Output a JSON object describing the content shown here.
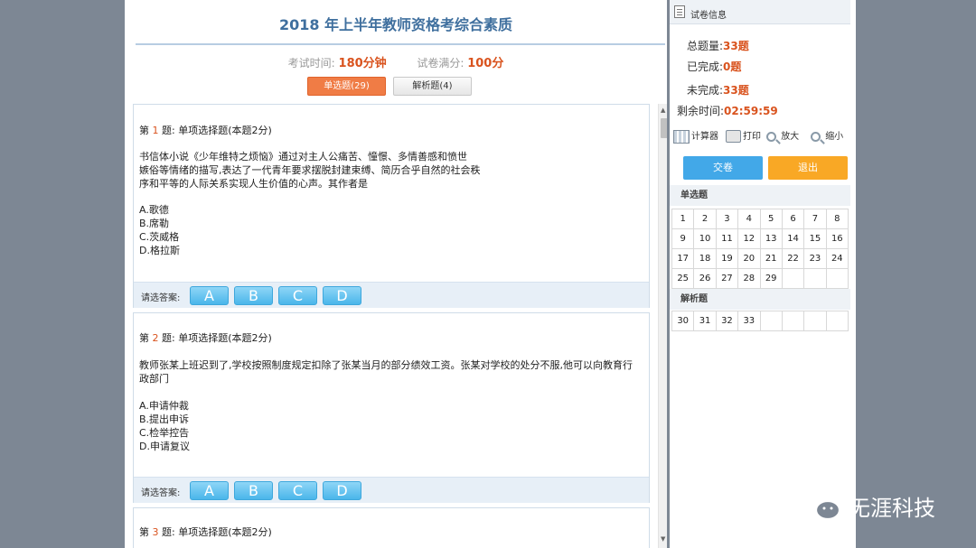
{
  "exam": {
    "title": "2018 年上半年教师资格考综合素质",
    "time_label": "考试时间:",
    "time_value": "180分钟",
    "score_label": "试卷满分:",
    "score_value": "100分"
  },
  "tabs": [
    {
      "label": "单选题(29)",
      "active": true
    },
    {
      "label": "解析题(4)",
      "active": false
    }
  ],
  "questions": [
    {
      "prefix": "第",
      "number": "1",
      "suffix": "题:  单项选择题(本题2分)",
      "text": "书信体小说《少年维特之烦恼》通过对主人公痛苦、憧憬、多情善感和愤世\n嫉俗等情绪的描写,表达了一代青年要求摆脱封建束缚、简历合乎自然的社会秩\n序和平等的人际关系实现人生价值的心声。其作者是",
      "options": [
        "A.歌德",
        "B.席勒",
        "C.茨威格",
        "D.格拉斯"
      ]
    },
    {
      "prefix": "第",
      "number": "2",
      "suffix": "题:  单项选择题(本题2分)",
      "text": "教师张某上班迟到了,学校按照制度规定扣除了张某当月的部分绩效工资。张某对学校的处分不服,他可以向教育行\n政部门",
      "options": [
        "A.申请仲裁",
        "B.提出申诉",
        "C.检举控告",
        "D.申请复议"
      ]
    },
    {
      "prefix": "第",
      "number": "3",
      "suffix": "题:  单项选择题(本题2分)"
    }
  ],
  "answer_label": "请选答案:",
  "answer_buttons": [
    "A",
    "B",
    "C",
    "D"
  ],
  "side": {
    "header": "试卷信息",
    "total_label": "总题量:",
    "total_value": "33题",
    "done_label": "已完成:",
    "done_value": "0题",
    "todo_label": "未完成:",
    "todo_value": "33题",
    "remain_label": "剩余时间:",
    "remain_value": "02:59:59",
    "tools": {
      "calculator": "计算器",
      "print": "打印",
      "zoom_in": "放大",
      "zoom_out": "缩小"
    },
    "submit": "交卷",
    "exit": "退出",
    "section1": "单选题",
    "section2": "解析题",
    "grid1": [
      [
        "1",
        "2",
        "3",
        "4",
        "5",
        "6",
        "7",
        "8"
      ],
      [
        "9",
        "10",
        "11",
        "12",
        "13",
        "14",
        "15",
        "16"
      ],
      [
        "17",
        "18",
        "19",
        "20",
        "21",
        "22",
        "23",
        "24"
      ],
      [
        "25",
        "26",
        "27",
        "28",
        "29",
        "",
        "",
        " "
      ]
    ],
    "grid2": [
      [
        "30",
        "31",
        "32",
        "33",
        "",
        "",
        "",
        ""
      ]
    ]
  },
  "watermark": "无涯科技"
}
